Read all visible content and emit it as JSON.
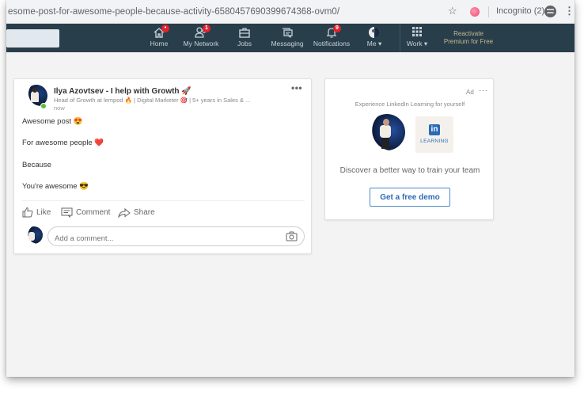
{
  "browser": {
    "url": "esome-post-for-awesome-people-because-activity-6580457690399674368-ovm0/",
    "profile_label": "Incognito (2)",
    "icons": [
      "star-icon",
      "extension-icon",
      "incognito-icon",
      "kebab-menu-icon"
    ]
  },
  "nav": {
    "items": [
      {
        "label": "Home",
        "icon": "home-icon",
        "badge": "•"
      },
      {
        "label": "My Network",
        "icon": "network-icon",
        "badge": "1"
      },
      {
        "label": "Jobs",
        "icon": "briefcase-icon",
        "badge": null
      },
      {
        "label": "Messaging",
        "icon": "messaging-icon",
        "badge": null
      },
      {
        "label": "Notifications",
        "icon": "bell-icon",
        "badge": "9"
      },
      {
        "label": "Me ▾",
        "icon": "avatar-icon",
        "badge": null
      },
      {
        "label": "Work ▾",
        "icon": "grid-icon",
        "badge": null
      }
    ],
    "premium_line1": "Reactivate",
    "premium_line2": "Premium for Free",
    "colors": {
      "bar": "#283e4a",
      "badge": "#e0232d",
      "premium": "#c8b890"
    }
  },
  "post": {
    "author_name": "Ilya Azovtsev - I help with Growth 🚀",
    "author_headline": "Head of Growth at lempod 🔥 | Digital Marketer 🎯 | 5+ years in Sales & ...",
    "time": "now",
    "more_label": "•••",
    "lines": [
      "Awesome post 😍",
      "For awesome people ❤️",
      "Because",
      "You're awesome 😎"
    ],
    "actions": {
      "like": "Like",
      "comment": "Comment",
      "share": "Share"
    },
    "comment_placeholder": "Add a comment..."
  },
  "ad": {
    "label": "Ad",
    "more_label": "···",
    "headline": "Experience LinkedIn Learning for yourself",
    "logo_text": "in",
    "logo_caption": "LEARNING",
    "tagline": "Discover a better way to train your team",
    "cta": "Get a free demo",
    "accent": "#2b6bb5"
  }
}
